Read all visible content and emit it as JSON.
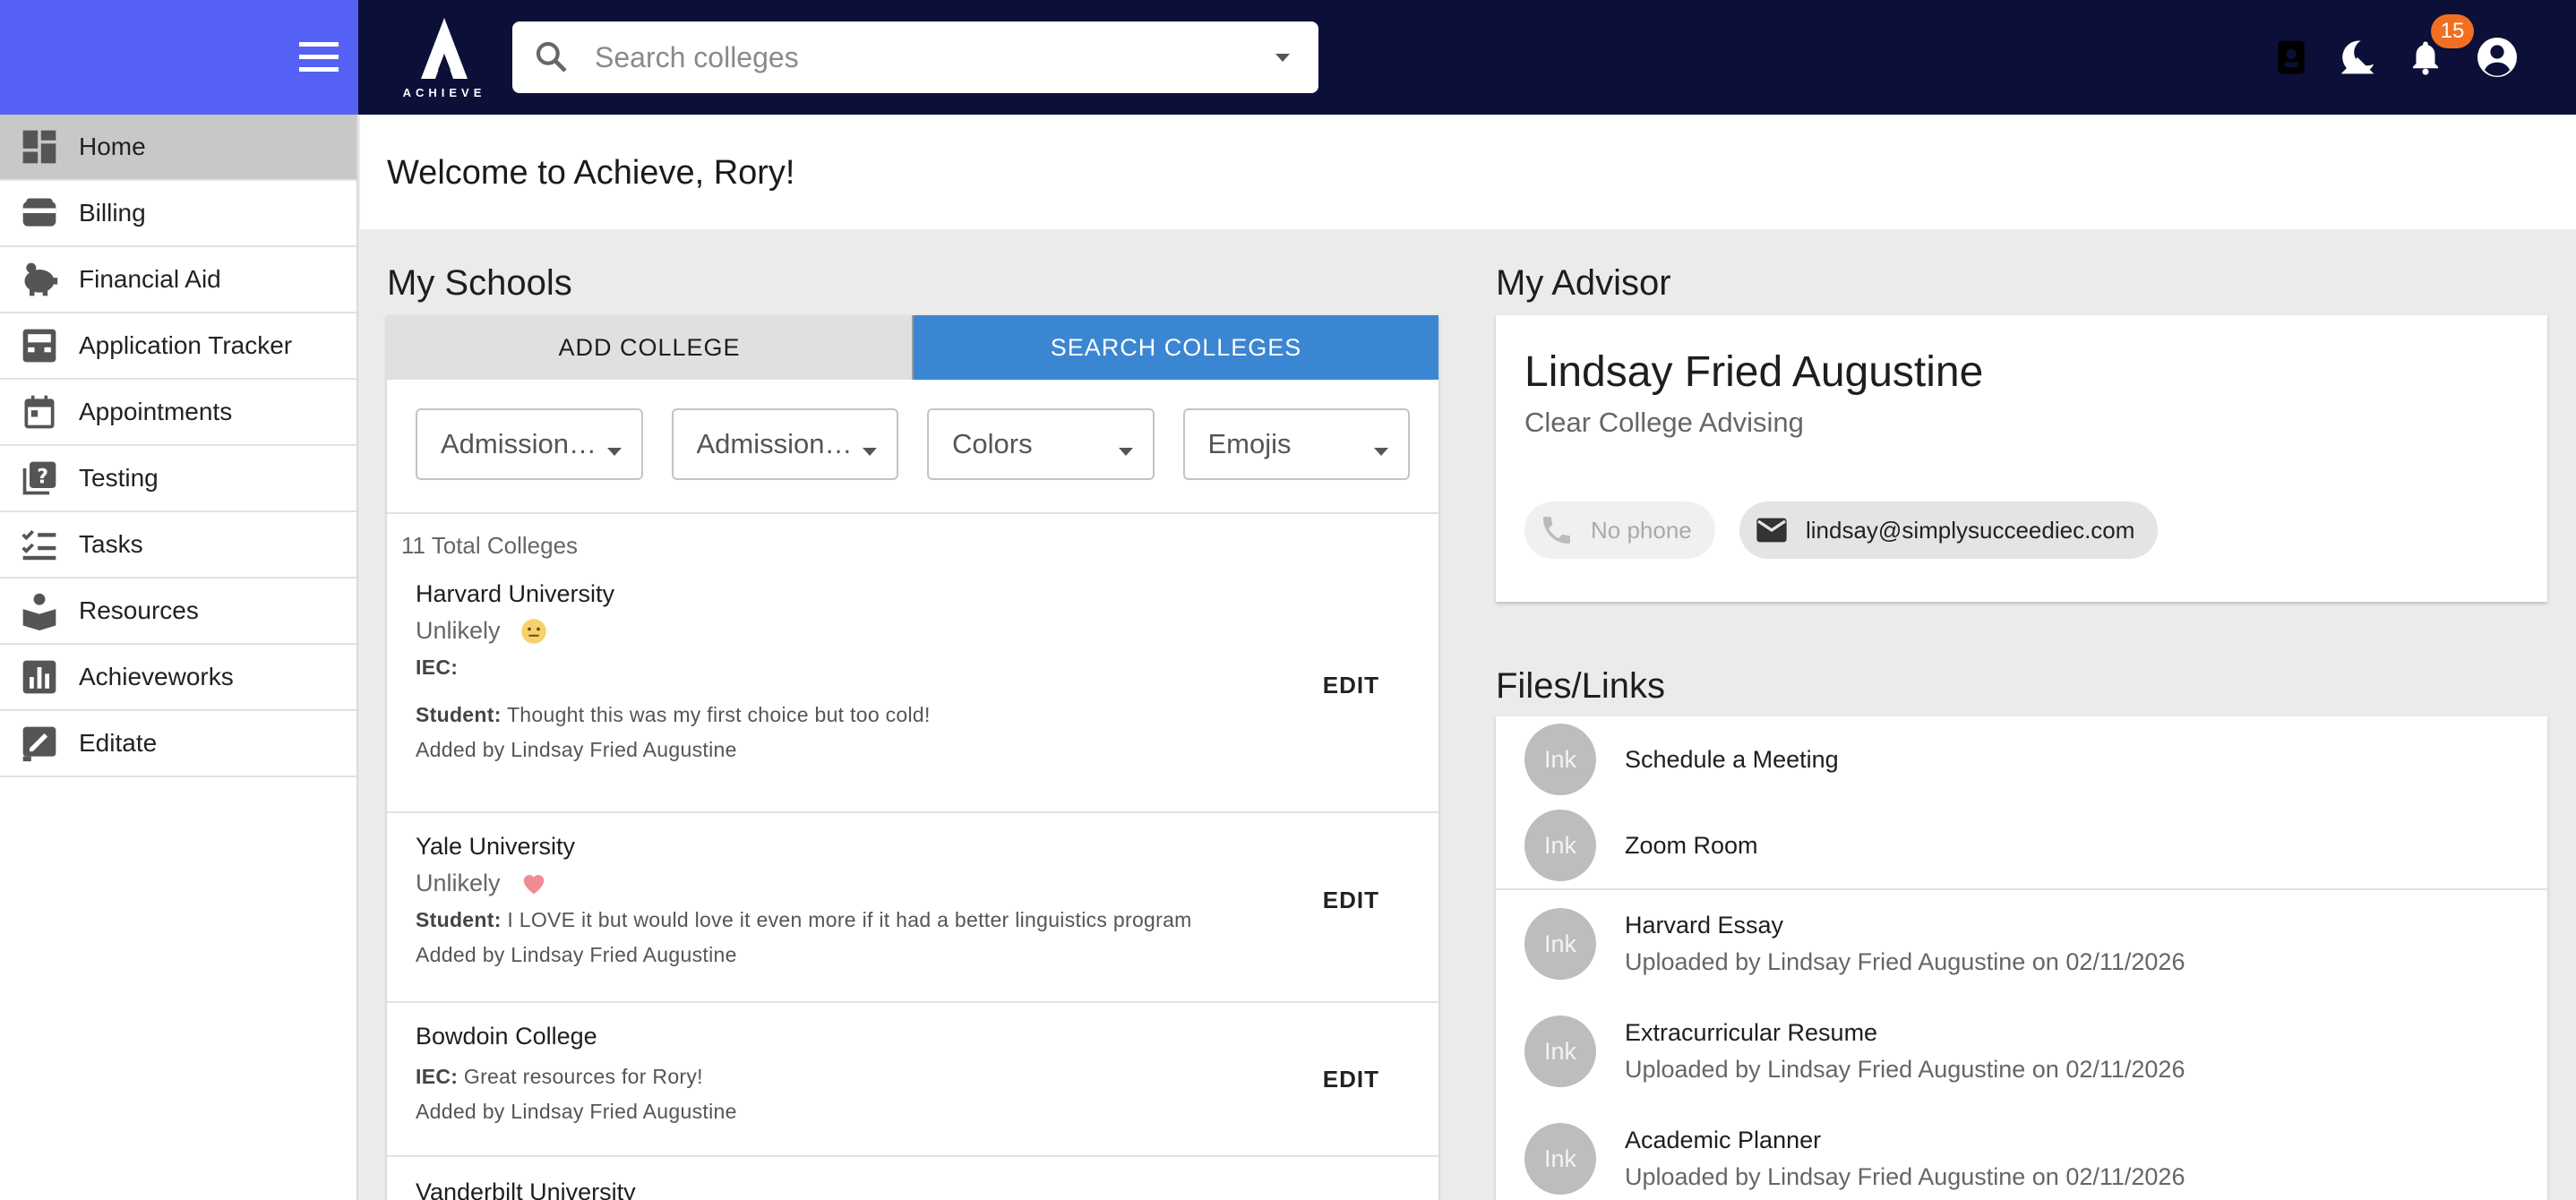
{
  "header": {
    "logo_text": "ACHIEVE",
    "search_placeholder": "Search colleges",
    "notification_count": "15"
  },
  "sidebar": {
    "items": [
      {
        "label": "Home",
        "icon": "dashboard-icon",
        "active": true
      },
      {
        "label": "Billing",
        "icon": "wallet-icon"
      },
      {
        "label": "Financial Aid",
        "icon": "piggy-bank-icon"
      },
      {
        "label": "Application Tracker",
        "icon": "inbox-tray-icon"
      },
      {
        "label": "Appointments",
        "icon": "calendar-icon"
      },
      {
        "label": "Testing",
        "icon": "quiz-icon"
      },
      {
        "label": "Tasks",
        "icon": "checklist-icon"
      },
      {
        "label": "Resources",
        "icon": "reading-icon"
      },
      {
        "label": "Achieveworks",
        "icon": "bar-chart-icon"
      },
      {
        "label": "Editate",
        "icon": "edit-note-icon"
      }
    ]
  },
  "main": {
    "welcome": "Welcome to Achieve, Rory!"
  },
  "schools": {
    "title": "My Schools",
    "tabs": {
      "add": "ADD COLLEGE",
      "search": "SEARCH COLLEGES"
    },
    "filters": [
      "Admission P...",
      "Admission D...",
      "Colors",
      "Emojis"
    ],
    "total": "11 Total Colleges",
    "edit_label": "EDIT",
    "colleges": [
      {
        "name": "Harvard University",
        "likelihood": "Unlikely",
        "iec_label": "IEC:",
        "iec": "",
        "student_label": "Student:",
        "student": "Thought this was my first choice but too cold!",
        "added_by": "Added by Lindsay Fried Augustine"
      },
      {
        "name": "Yale University",
        "likelihood": "Unlikely",
        "student_label": "Student:",
        "student": "I LOVE it but would love it even more if it had a better linguistics program",
        "added_by": "Added by Lindsay Fried Augustine"
      },
      {
        "name": "Bowdoin College",
        "iec_label": "IEC:",
        "iec": "Great resources for Rory!",
        "added_by": "Added by Lindsay Fried Augustine"
      },
      {
        "name": "Vanderbilt University"
      }
    ]
  },
  "advisor": {
    "title": "My Advisor",
    "name": "Lindsay Fried Augustine",
    "org": "Clear College Advising",
    "phone": "No phone",
    "email": "lindsay@simplysucceediec.com"
  },
  "files": {
    "title": "Files/Links",
    "avatar_text": "Ink",
    "links": [
      {
        "title": "Schedule a Meeting"
      },
      {
        "title": "Zoom Room"
      }
    ],
    "documents": [
      {
        "title": "Harvard Essay",
        "sub": "Uploaded by Lindsay Fried Augustine on 02/11/2026"
      },
      {
        "title": "Extracurricular Resume",
        "sub": "Uploaded by Lindsay Fried Augustine on 02/11/2026"
      },
      {
        "title": "Academic Planner",
        "sub": "Uploaded by Lindsay Fried Augustine on 02/11/2026"
      }
    ]
  },
  "colors": {
    "topbar": "#0c1038",
    "drawer_header": "#5461f4",
    "search_tab": "#3b86d3",
    "badge": "#f26f21"
  }
}
